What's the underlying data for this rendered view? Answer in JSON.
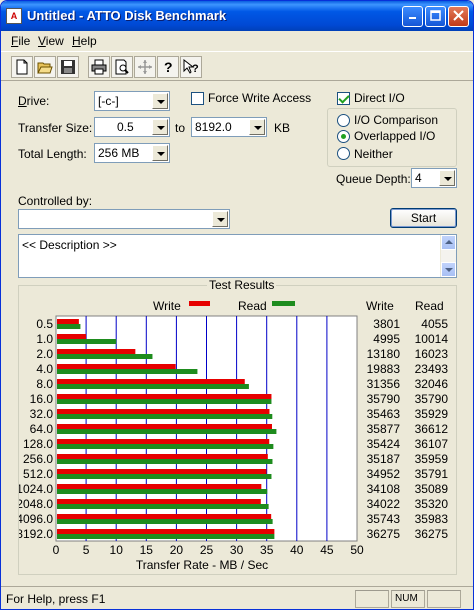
{
  "window": {
    "title": "Untitled - ATTO Disk Benchmark",
    "app_icon": "disk-benchmark-icon"
  },
  "menu": {
    "file": "File",
    "view": "View",
    "help": "Help"
  },
  "toolbar": {
    "icons": [
      "new-icon",
      "open-icon",
      "save-icon",
      "print-icon",
      "print-preview-icon",
      "move-icon",
      "help-icon",
      "context-help-icon"
    ]
  },
  "form": {
    "drive_label": "Drive:",
    "drive_value": "[-c-]",
    "force_write_label": "Force Write Access",
    "direct_io_label": "Direct I/O",
    "transfer_size_label": "Transfer Size:",
    "transfer_from": "0.5",
    "to_label": "to",
    "transfer_to": "8192.0",
    "kb_label": "KB",
    "total_length_label": "Total Length:",
    "total_length_value": "256 MB",
    "io_comparison_label": "I/O Comparison",
    "overlapped_io_label": "Overlapped I/O",
    "neither_label": "Neither",
    "queue_depth_label": "Queue Depth:",
    "queue_depth_value": "4",
    "controlled_by_label": "Controlled by:",
    "controlled_by_value": "",
    "start_label": "Start",
    "description_text": "<< Description >>",
    "force_write_checked": false,
    "direct_io_checked": true,
    "selected_io_mode": "Overlapped I/O"
  },
  "results": {
    "group_title": "Test Results",
    "legend_write": "Write",
    "legend_read": "Read",
    "col_write": "Write",
    "col_read": "Read",
    "write_color": "#E60000",
    "read_color": "#1E8C1E",
    "grid_color": "#0000C8"
  },
  "chart_data": {
    "type": "bar",
    "orientation": "horizontal",
    "title": "Test Results",
    "xlabel": "Transfer Rate - MB / Sec",
    "xlim": [
      0,
      50
    ],
    "x_ticks": [
      "0",
      "5",
      "10",
      "15",
      "20",
      "25",
      "30",
      "35",
      "40",
      "45",
      "50"
    ],
    "categories": [
      "0.5",
      "1.0",
      "2.0",
      "4.0",
      "8.0",
      "16.0",
      "32.0",
      "64.0",
      "128.0",
      "256.0",
      "512.0",
      "1024.0",
      "2048.0",
      "4096.0",
      "8192.0"
    ],
    "series": [
      {
        "name": "Write",
        "values": [
          3801,
          4995,
          13180,
          19883,
          31356,
          35790,
          35463,
          35877,
          35424,
          35187,
          34952,
          34108,
          34022,
          35743,
          36275
        ]
      },
      {
        "name": "Read",
        "values": [
          4055,
          10014,
          16023,
          23493,
          32046,
          35790,
          35929,
          36612,
          36107,
          35959,
          35791,
          35089,
          35320,
          35983,
          36275
        ]
      }
    ]
  },
  "statusbar": {
    "help_text": "For Help, press F1",
    "num": "NUM"
  }
}
